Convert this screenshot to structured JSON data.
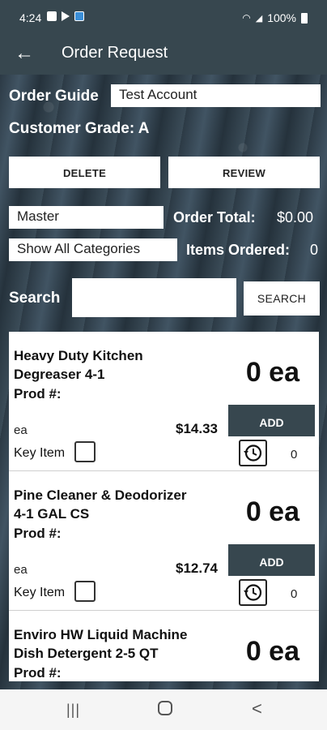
{
  "status_bar": {
    "time": "4:24",
    "battery": "100%"
  },
  "app_bar": {
    "title": "Order Request"
  },
  "order_guide": {
    "label": "Order Guide",
    "value": "Test Account"
  },
  "customer_grade": "Customer Grade: A",
  "buttons": {
    "delete": "DELETE",
    "review": "REVIEW",
    "search": "SEARCH"
  },
  "guide_select": "Master",
  "category_select": "Show All Categories",
  "order_total": {
    "label": "Order Total:",
    "value": "$0.00"
  },
  "items_ordered": {
    "label": "Items Ordered:",
    "value": "0"
  },
  "search": {
    "label": "Search",
    "value": ""
  },
  "products": [
    {
      "name": "Heavy Duty Kitchen Degreaser 4-1",
      "prod": "Prod #:",
      "qty": "0 ea",
      "unit": "ea",
      "price": "$14.33",
      "add": "ADD",
      "key_item": "Key Item",
      "history_count": "0"
    },
    {
      "name": "Pine Cleaner & Deodorizer 4-1 GAL CS",
      "prod": "Prod #:",
      "qty": "0 ea",
      "unit": "ea",
      "price": "$12.74",
      "add": "ADD",
      "key_item": "Key Item",
      "history_count": "0"
    },
    {
      "name": "Enviro HW Liquid Machine Dish Detergent 2-5 QT",
      "prod": "Prod #:",
      "qty": "0 ea"
    }
  ],
  "colors": {
    "app_bar": "#37474f",
    "add_button": "#37474f"
  },
  "icons": [
    "back-arrow-icon",
    "history-icon",
    "checkbox-icon",
    "recents-icon",
    "home-icon",
    "back-icon"
  ]
}
